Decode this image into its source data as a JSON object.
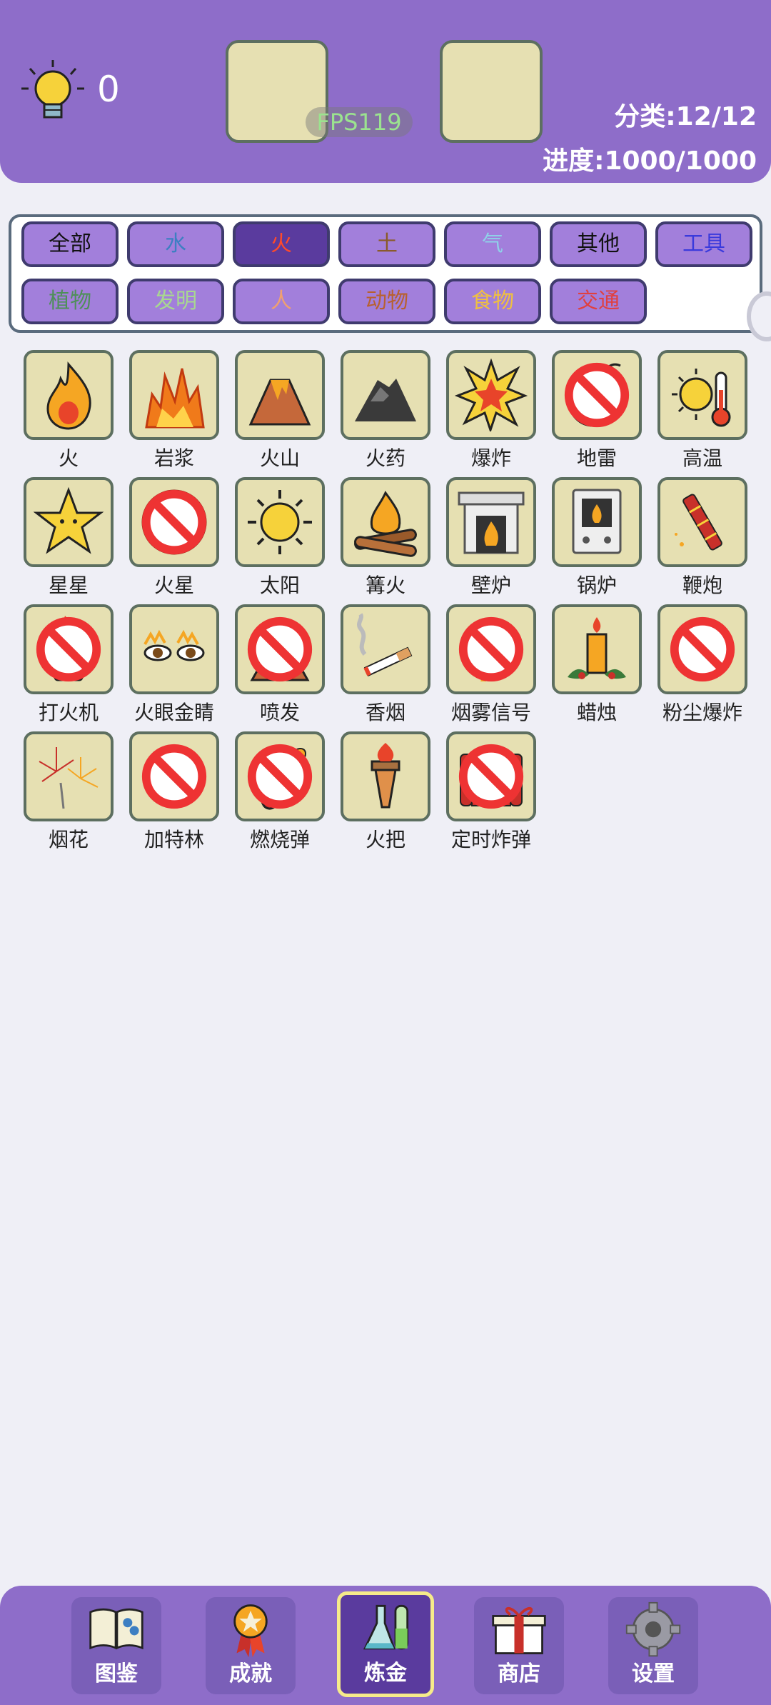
{
  "header": {
    "hint_count": "0",
    "fps": "FPS119",
    "category_stat": "分类:12/12",
    "progress_stat": "进度:1000/1000"
  },
  "filters": [
    {
      "label": "全部",
      "color": "#111111"
    },
    {
      "label": "水",
      "color": "#3d7fc2"
    },
    {
      "label": "火",
      "color": "#ff4a2a",
      "active": true
    },
    {
      "label": "土",
      "color": "#8a5a2a"
    },
    {
      "label": "气",
      "color": "#8fd0e8"
    },
    {
      "label": "其他",
      "color": "#111111"
    },
    {
      "label": "工具",
      "color": "#3a3adc"
    },
    {
      "label": "植物",
      "color": "#4f8f5a"
    },
    {
      "label": "发明",
      "color": "#a8d890"
    },
    {
      "label": "人",
      "color": "#f0a070"
    },
    {
      "label": "动物",
      "color": "#b86030"
    },
    {
      "label": "食物",
      "color": "#f0c040"
    },
    {
      "label": "交通",
      "color": "#e04040"
    }
  ],
  "items": [
    {
      "label": "火",
      "icon": "fire-icon",
      "locked": false
    },
    {
      "label": "岩浆",
      "icon": "magma-icon",
      "locked": false
    },
    {
      "label": "火山",
      "icon": "volcano-icon",
      "locked": false
    },
    {
      "label": "火药",
      "icon": "gunpowder-icon",
      "locked": false
    },
    {
      "label": "爆炸",
      "icon": "explosion-icon",
      "locked": false
    },
    {
      "label": "地雷",
      "icon": "bomb-icon",
      "locked": true
    },
    {
      "label": "高温",
      "icon": "heat-icon",
      "locked": false
    },
    {
      "label": "星星",
      "icon": "star-icon",
      "locked": false
    },
    {
      "label": "火星",
      "icon": "mars-icon",
      "locked": true
    },
    {
      "label": "太阳",
      "icon": "sun-icon",
      "locked": false
    },
    {
      "label": "篝火",
      "icon": "campfire-icon",
      "locked": false
    },
    {
      "label": "壁炉",
      "icon": "fireplace-icon",
      "locked": false
    },
    {
      "label": "锅炉",
      "icon": "boiler-icon",
      "locked": false
    },
    {
      "label": "鞭炮",
      "icon": "firecracker-icon",
      "locked": false
    },
    {
      "label": "打火机",
      "icon": "lighter-icon",
      "locked": true
    },
    {
      "label": "火眼金睛",
      "icon": "fiery-eyes-icon",
      "locked": false
    },
    {
      "label": "喷发",
      "icon": "eruption-icon",
      "locked": true
    },
    {
      "label": "香烟",
      "icon": "cigarette-icon",
      "locked": false
    },
    {
      "label": "烟雾信号",
      "icon": "smoke-signal-icon",
      "locked": true
    },
    {
      "label": "蜡烛",
      "icon": "candle-icon",
      "locked": false
    },
    {
      "label": "粉尘爆炸",
      "icon": "dust-explosion-icon",
      "locked": true
    },
    {
      "label": "烟花",
      "icon": "fireworks-icon",
      "locked": false
    },
    {
      "label": "加特林",
      "icon": "gatling-icon",
      "locked": true
    },
    {
      "label": "燃烧弹",
      "icon": "molotov-icon",
      "locked": true
    },
    {
      "label": "火把",
      "icon": "torch-icon",
      "locked": false
    },
    {
      "label": "定时炸弹",
      "icon": "time-bomb-icon",
      "locked": true
    }
  ],
  "nav": [
    {
      "label": "图鉴",
      "icon": "book-icon"
    },
    {
      "label": "成就",
      "icon": "medal-icon"
    },
    {
      "label": "炼金",
      "icon": "flask-icon",
      "active": true
    },
    {
      "label": "商店",
      "icon": "gift-icon"
    },
    {
      "label": "设置",
      "icon": "gear-icon"
    }
  ]
}
